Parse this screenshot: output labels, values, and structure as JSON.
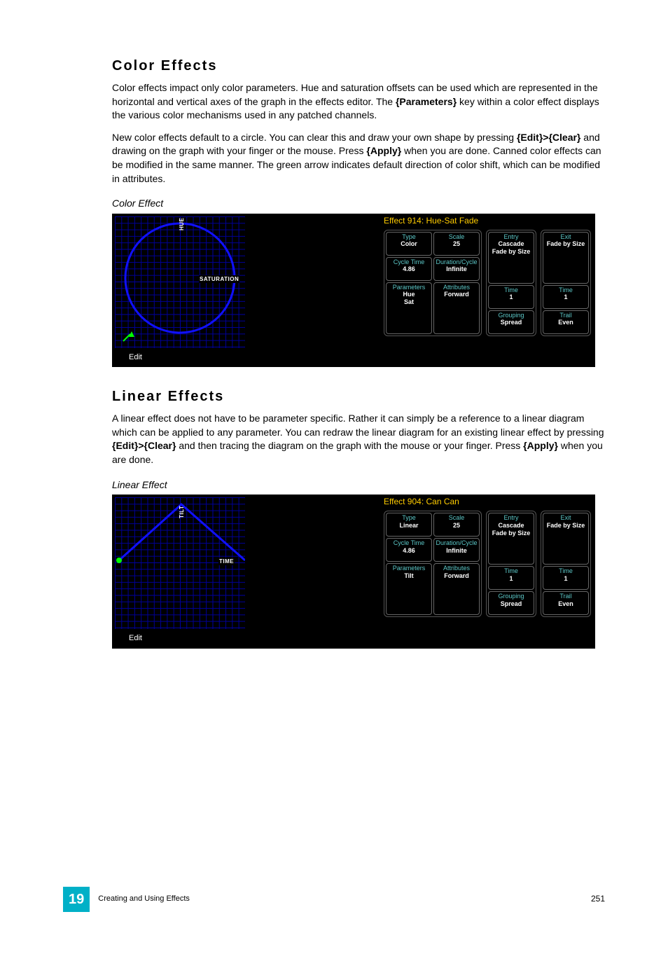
{
  "section1": {
    "heading": "Color Effects",
    "p1_a": "Color effects impact only color parameters. Hue and saturation offsets can be used which are represented in the horizontal and vertical axes of the graph in the effects editor. The ",
    "p1_b": "{Parameters}",
    "p1_c": " key within a color effect displays the various color mechanisms used in any patched channels.",
    "p2_a": "New color effects default to a circle. You can clear this and draw your own shape by pressing ",
    "p2_b": "{Edit}>{Clear}",
    "p2_c": " and drawing on the graph with your finger or the mouse. Press ",
    "p2_d": "{Apply}",
    "p2_e": " when you are done. Canned color effects can be modified in the same manner. The green arrow indicates default direction of color shift, which can be modified in attributes.",
    "caption": "Color Effect"
  },
  "panel1": {
    "title": "Effect 914: Hue-Sat Fade",
    "axis_v": "HUE",
    "axis_h": "SATURATION",
    "edit": "Edit",
    "cells": {
      "type_l": "Type",
      "type_v": "Color",
      "scale_l": "Scale",
      "scale_v": "25",
      "cycle_l": "Cycle Time",
      "cycle_v": "4.86",
      "dur_l": "Duration/Cycle",
      "dur_v": "Infinite",
      "param_l": "Parameters",
      "param_v1": "Hue",
      "param_v2": "Sat",
      "attr_l": "Attributes",
      "attr_v": "Forward",
      "entry_l": "Entry",
      "entry_v1": "Cascade",
      "entry_v2": "Fade by Size",
      "exit_l": "Exit",
      "exit_v": "Fade by Size",
      "time1_l": "Time",
      "time1_v": "1",
      "time2_l": "Time",
      "time2_v": "1",
      "group_l": "Grouping",
      "group_v": "Spread",
      "trail_l": "Trail",
      "trail_v": "Even"
    }
  },
  "section2": {
    "heading": "Linear Effects",
    "p1_a": "A linear effect does not have to be parameter specific. Rather it can simply be a reference to a linear diagram which can be applied to any parameter. You can redraw the linear diagram for an existing linear effect by pressing ",
    "p1_b": "{Edit}>{Clear}",
    "p1_c": " and then tracing the diagram on the graph with the mouse or your finger. Press ",
    "p1_d": "{Apply}",
    "p1_e": " when you are done.",
    "caption": "Linear Effect"
  },
  "panel2": {
    "title": "Effect 904: Can Can",
    "axis_v": "TILT",
    "axis_h": "TIME",
    "edit": "Edit",
    "cells": {
      "type_l": "Type",
      "type_v": "Linear",
      "scale_l": "Scale",
      "scale_v": "25",
      "cycle_l": "Cycle Time",
      "cycle_v": "4.86",
      "dur_l": "Duration/Cycle",
      "dur_v": "Infinite",
      "param_l": "Parameters",
      "param_v": "Tilt",
      "attr_l": "Attributes",
      "attr_v": "Forward",
      "entry_l": "Entry",
      "entry_v1": "Cascade",
      "entry_v2": "Fade by Size",
      "exit_l": "Exit",
      "exit_v": "Fade by Size",
      "time1_l": "Time",
      "time1_v": "1",
      "time2_l": "Time",
      "time2_v": "1",
      "group_l": "Grouping",
      "group_v": "Spread",
      "trail_l": "Trail",
      "trail_v": "Even"
    }
  },
  "footer": {
    "chapter": "19",
    "title": "Creating and Using Effects",
    "page": "251"
  }
}
